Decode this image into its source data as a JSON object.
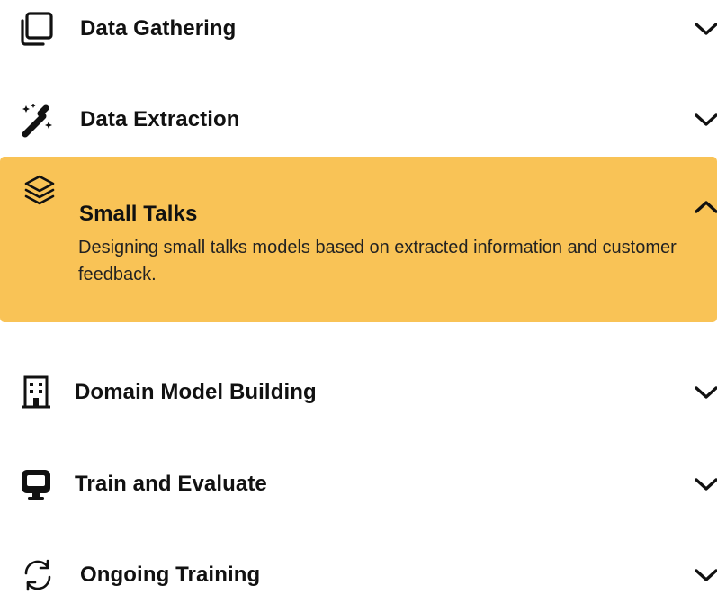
{
  "items": [
    {
      "title": "Data Gathering",
      "icon": "copy-icon",
      "expanded": false
    },
    {
      "title": "Data Extraction",
      "icon": "magic-wand-icon",
      "expanded": false
    },
    {
      "title": "Small Talks",
      "icon": "layers-icon",
      "expanded": true,
      "description": "Designing small talks models based on extracted information and customer feedback."
    },
    {
      "title": "Domain Model Building",
      "icon": "building-icon",
      "expanded": false
    },
    {
      "title": "Train and Evaluate",
      "icon": "monitor-icon",
      "expanded": false
    },
    {
      "title": "Ongoing Training",
      "icon": "refresh-icon",
      "expanded": false
    }
  ],
  "colors": {
    "expanded_background": "#f9c356",
    "text": "#111111"
  }
}
